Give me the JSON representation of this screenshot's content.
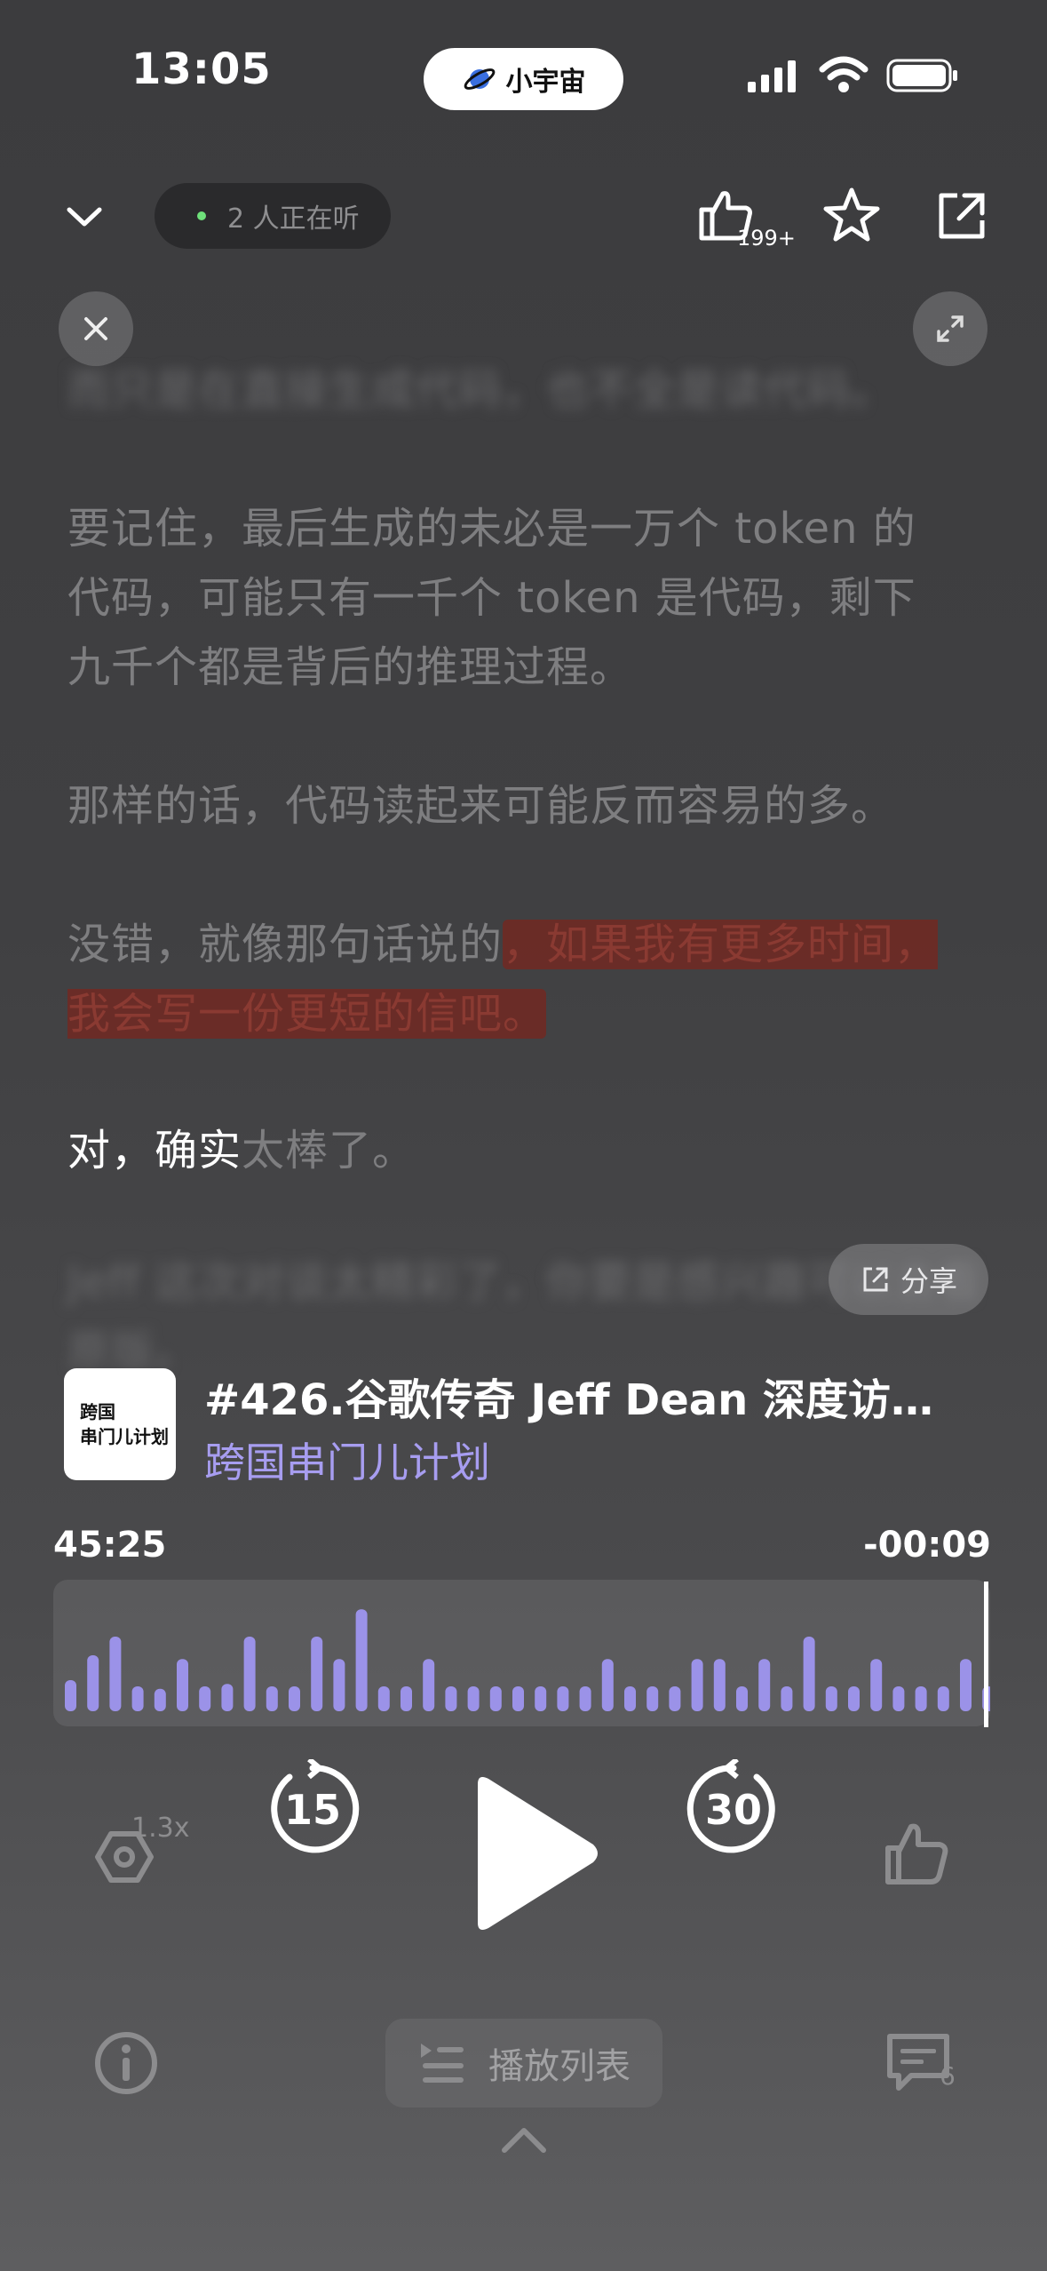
{
  "status_bar": {
    "time": "13:05",
    "app_pill": "小宇宙"
  },
  "header": {
    "listening": "2 人正在听",
    "like_count": "199+"
  },
  "transcript": {
    "blur_top": "而只是在直接生成代码，也不全是读代码。",
    "p1": "要记住，最后生成的未必是一万个 token 的代码，可能只有一千个 token 是代码，剩下九千个都是背后的推理过程。",
    "p2": "那样的话，代码读起来可能反而容易的多。",
    "p3_plain": "没错，就像那句话说的",
    "p3_highlight": "，如果我有更多时间，我会写一份更短的信吧。",
    "p4_bright": "对，确实",
    "p4_dim": "太棒了。",
    "blur_bottom": "Jeff 这次对谈太精彩了，你要是感兴趣可以去看原版。"
  },
  "share_label": "分享",
  "episode": {
    "title": "#426.谷歌传奇 Jeff Dean 深度访谈…",
    "podcast": "跨国串门儿计划",
    "cover_line1": "跨国",
    "cover_line2": "串门儿计划"
  },
  "progress": {
    "elapsed": "45:25",
    "remaining": "-00:09",
    "fraction": 0.996
  },
  "waveform": [
    0.25,
    0.45,
    0.6,
    0.2,
    0.18,
    0.42,
    0.2,
    0.22,
    0.6,
    0.2,
    0.2,
    0.6,
    0.42,
    0.82,
    0.2,
    0.2,
    0.42,
    0.2,
    0.2,
    0.2,
    0.2,
    0.2,
    0.2,
    0.2,
    0.42,
    0.2,
    0.2,
    0.2,
    0.42,
    0.42,
    0.2,
    0.42,
    0.2,
    0.6,
    0.2,
    0.2,
    0.42,
    0.2,
    0.2,
    0.2,
    0.42,
    0.2,
    0.42
  ],
  "controls": {
    "speed": "1.3x",
    "rewind": "15",
    "forward": "30",
    "comments_count": "6"
  },
  "playlist_label": "播放列表",
  "colors": {
    "accent": "#a79df0",
    "wave": "#9b92e8",
    "highlight": "#78261e"
  }
}
